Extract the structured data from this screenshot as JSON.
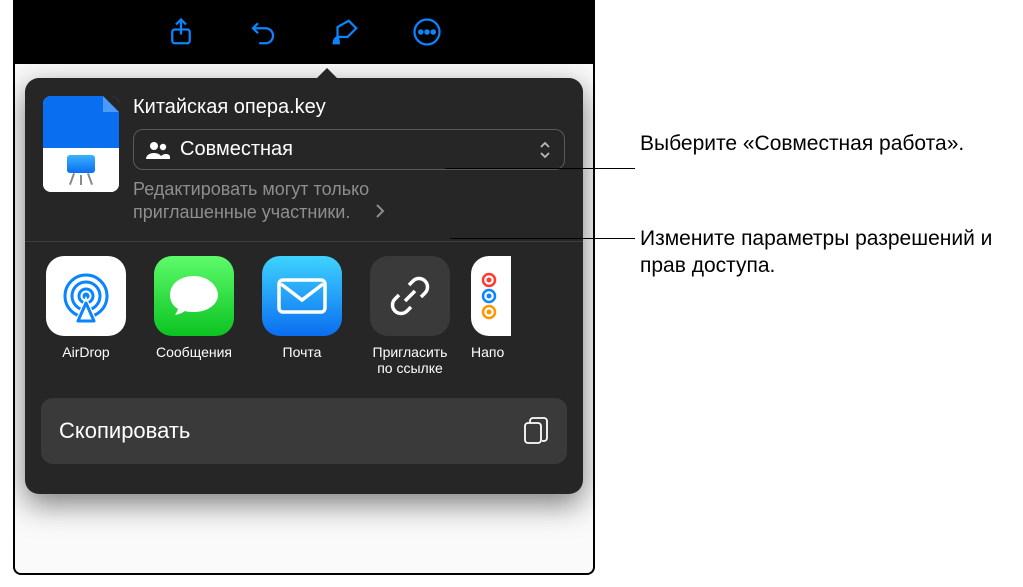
{
  "document": {
    "title": "Китайская опера.key"
  },
  "collab": {
    "mode_label": "Совместная",
    "permissions_line1": "Редактировать могут только",
    "permissions_line2": "приглашенные участники."
  },
  "apps": [
    {
      "id": "airdrop",
      "label": "AirDrop"
    },
    {
      "id": "messages",
      "label": "Сообщения"
    },
    {
      "id": "mail",
      "label": "Почта"
    },
    {
      "id": "invite-link",
      "label": "Пригласить\nпо ссылке"
    },
    {
      "id": "reminders",
      "label": "Напо"
    }
  ],
  "actions": {
    "copy_label": "Скопировать"
  },
  "callouts": {
    "c1": "Выберите «Совместная работа».",
    "c2": "Измените параметры разрешений и прав доступа."
  }
}
